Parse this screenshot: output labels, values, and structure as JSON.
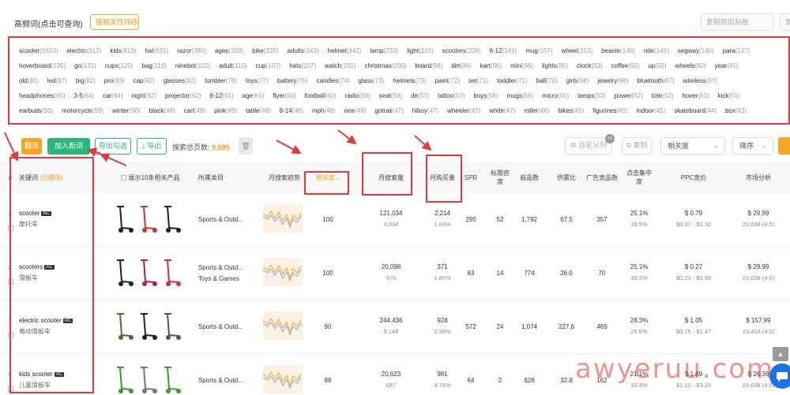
{
  "header": {
    "title": "高频词(点击可查询)",
    "dropdown_label": "按相关性排序",
    "copy_buttons": [
      "复制到剪贴板",
      "复制"
    ]
  },
  "keywords": {
    "rows": [
      [
        [
          "scooter",
          "(1633)"
        ],
        [
          "electric",
          "(912)"
        ],
        [
          "kids",
          "(813)"
        ],
        [
          "hat",
          "(631)"
        ],
        [
          "razor",
          "(385)"
        ],
        [
          "ages",
          "(339)"
        ],
        [
          "bike",
          "(335)"
        ],
        [
          "adults",
          "(343)"
        ],
        [
          "helmet",
          "(342)"
        ],
        [
          "lamp",
          "(233)"
        ],
        [
          "light",
          "(215)"
        ],
        [
          "scooters",
          "(208)"
        ],
        [
          "6-12",
          "(161)"
        ],
        [
          "mug",
          "(157)"
        ],
        [
          "wheel",
          "(153)"
        ],
        [
          "beanie",
          "(148)"
        ],
        [
          "ride",
          "(141)"
        ],
        [
          "segway",
          "(140)"
        ],
        [
          "para",
          "(137)"
        ]
      ],
      [
        [
          "hoverboard",
          "(135)"
        ],
        [
          "go",
          "(131)"
        ],
        [
          "cups",
          "(125)"
        ],
        [
          "bag",
          "(118)"
        ],
        [
          "ninebot",
          "(112)"
        ],
        [
          "adult",
          "(110)"
        ],
        [
          "cup",
          "(107)"
        ],
        [
          "hats",
          "(107)"
        ],
        [
          "watch",
          "(101)"
        ],
        [
          "christmas",
          "(100)"
        ],
        [
          "board",
          "(98)"
        ],
        [
          "dirt",
          "(96)"
        ],
        [
          "kart",
          "(96)"
        ],
        [
          "mini",
          "(96)"
        ],
        [
          "lights",
          "(95)"
        ],
        [
          "clock",
          "(93)"
        ],
        [
          "coffee",
          "(92)"
        ],
        [
          "up",
          "(92)"
        ],
        [
          "wheels",
          "(82)"
        ],
        [
          "year",
          "(81)"
        ]
      ],
      [
        [
          "old",
          "(80)"
        ],
        [
          "led",
          "(87)"
        ],
        [
          "big",
          "(82)"
        ],
        [
          "pro",
          "(83)"
        ],
        [
          "cap",
          "(82)"
        ],
        [
          "glasses",
          "(82)"
        ],
        [
          "tumbler",
          "(78)"
        ],
        [
          "toys",
          "(77)"
        ],
        [
          "battery",
          "(75)"
        ],
        [
          "candles",
          "(74)"
        ],
        [
          "glass",
          "(73)"
        ],
        [
          "helmets",
          "(73)"
        ],
        [
          "paint",
          "(72)"
        ],
        [
          "set",
          "(71)"
        ],
        [
          "toddler",
          "(71)"
        ],
        [
          "ball",
          "(70)"
        ],
        [
          "girls",
          "(68)"
        ],
        [
          "jewelry",
          "(68)"
        ],
        [
          "bluetooth",
          "(67)"
        ],
        [
          "wireless",
          "(67)"
        ]
      ],
      [
        [
          "headphones",
          "(65)"
        ],
        [
          "3-5",
          "(64)"
        ],
        [
          "car",
          "(64)"
        ],
        [
          "night",
          "(62)"
        ],
        [
          "projector",
          "(62)"
        ],
        [
          "8-12",
          "(61)"
        ],
        [
          "age",
          "(61)"
        ],
        [
          "flyer",
          "(60)"
        ],
        [
          "football",
          "(60)"
        ],
        [
          "radio",
          "(59)"
        ],
        [
          "seat",
          "(59)"
        ],
        [
          "de",
          "(57)"
        ],
        [
          "tattoo",
          "(57)"
        ],
        [
          "boys",
          "(56)"
        ],
        [
          "mugs",
          "(56)"
        ],
        [
          "micro",
          "(55)"
        ],
        [
          "lamps",
          "(52)"
        ],
        [
          "power",
          "(52)"
        ],
        [
          "tote",
          "(52)"
        ],
        [
          "hover",
          "(51)"
        ],
        [
          "kick",
          "(51)"
        ]
      ],
      [
        [
          "earbuds",
          "(50)"
        ],
        [
          "motorcycle",
          "(50)"
        ],
        [
          "winter",
          "(50)"
        ],
        [
          "black",
          "(49)"
        ],
        [
          "cart",
          "(49)"
        ],
        [
          "pink",
          "(49)"
        ],
        [
          "table",
          "(49)"
        ],
        [
          "8-14",
          "(48)"
        ],
        [
          "mph",
          "(48)"
        ],
        [
          "one",
          "(48)"
        ],
        [
          "gotrax",
          "(47)"
        ],
        [
          "hiboy",
          "(47)"
        ],
        [
          "wheeler",
          "(47)"
        ],
        [
          "white",
          "(47)"
        ],
        [
          "roller",
          "(46)"
        ],
        [
          "bikes",
          "(45)"
        ],
        [
          "figurines",
          "(45)"
        ],
        [
          "indoor",
          "(45)"
        ],
        [
          "skateboard",
          "(44)"
        ],
        [
          "box",
          "(43)"
        ]
      ]
    ]
  },
  "toolbar": {
    "btn_translate": "翻译",
    "btn_add": "加入新词",
    "btn_export_selected": "导出勾选",
    "btn_export": "导出",
    "total_label": "搜索总页数:",
    "total_value": "9,595",
    "btn_custom": "自定义列",
    "custom_badge": "+1",
    "btn_copy": "复制",
    "sort_field": "相关度",
    "sort_order": "降序"
  },
  "table": {
    "headers": {
      "index": "#",
      "keyword": "关键词",
      "keyword_sub": "(已翻译)",
      "products": "展示10条相关产品",
      "category": "所属类目",
      "trend": "月搜索趋势",
      "relevance": "相关度",
      "relevance_arrow": "↓",
      "monthly_search": "月搜索量",
      "monthly_purchase": "月购买量",
      "spr": "SPR",
      "title_density": "标题密度",
      "products_count": "商品数",
      "supply_ratio": "供需比",
      "ad_products": "广告竞品数",
      "click_concentration": "点击集中度",
      "ppc": "PPC竞价",
      "market": "市场分析"
    },
    "rows": [
      {
        "index": "1",
        "keyword": "scooter",
        "tag": "AC",
        "translation": "摩托车",
        "category": [
          "Sports & Outd..."
        ],
        "relevance": "100",
        "search": "121,034",
        "search_sub": "4,034",
        "purchase": "2,214",
        "purchase_sub": "1.83%",
        "spr": "295",
        "title_density": "52",
        "products": "1,792",
        "supply": "67.5",
        "ads": "357",
        "click": "25.1%",
        "click_sub": "39.5%",
        "ppc": "$ 0.79",
        "ppc_sub": "$0.37 - $1.32",
        "market": "$ 29.99",
        "market_sub": "20,638 (4.5)"
      },
      {
        "index": "2",
        "keyword": "scooters",
        "tag": "AC",
        "translation": "滑板车",
        "category": [
          "Sports & Outd...",
          "Toys & Games"
        ],
        "relevance": "100",
        "search": "20,098",
        "search_sub": "670",
        "purchase": "371",
        "purchase_sub": "1.85%",
        "spr": "63",
        "title_density": "14",
        "products": "774",
        "supply": "26.0",
        "ads": "70",
        "click": "25.1%",
        "click_sub": "39.5%",
        "ppc": "$ 0.27",
        "ppc_sub": "$0.23 - $0.58",
        "market": "$ 29.99",
        "market_sub": "20,638 (4.5)"
      },
      {
        "index": "3",
        "keyword": "electric scooter",
        "tag": "AC",
        "translation": "电动滑板车",
        "category": [
          "Sports & Outd..."
        ],
        "relevance": "90",
        "search": "244,436",
        "search_sub": "8,148",
        "purchase": "928",
        "purchase_sub": "0.38%",
        "spr": "572",
        "title_density": "24",
        "products": "1,074",
        "supply": "227.6",
        "ads": "469",
        "click": "28.3%",
        "click_sub": "25.6%",
        "ppc": "$ 1.05",
        "ppc_sub": "$0.75 - $1.47",
        "market": "$ 157.99",
        "market_sub": "13,410 (4.5)"
      },
      {
        "index": "4",
        "keyword": "kids scooter",
        "tag": "AC",
        "translation": "儿童滑板车",
        "category": [
          "Sports & Outd..."
        ],
        "relevance": "88",
        "search": "20,623",
        "search_sub": "687",
        "purchase": "981",
        "purchase_sub": "4.76%",
        "spr": "64",
        "title_density": "2",
        "products": "628",
        "supply": "32.8",
        "ads": "162",
        "click": "21.1%",
        "click_sub": "33.8%",
        "ppc": "$ 1.69",
        "ppc_sub": "$1.12 - $3.15",
        "market": "$ 26.38",
        "market_sub": "20,638 (4.5)"
      }
    ]
  },
  "watermark": "awyeruu.com",
  "colors": {
    "annotation": "#e03a3a",
    "accent_orange": "#f5a623",
    "accent_green": "#2cb67d"
  }
}
